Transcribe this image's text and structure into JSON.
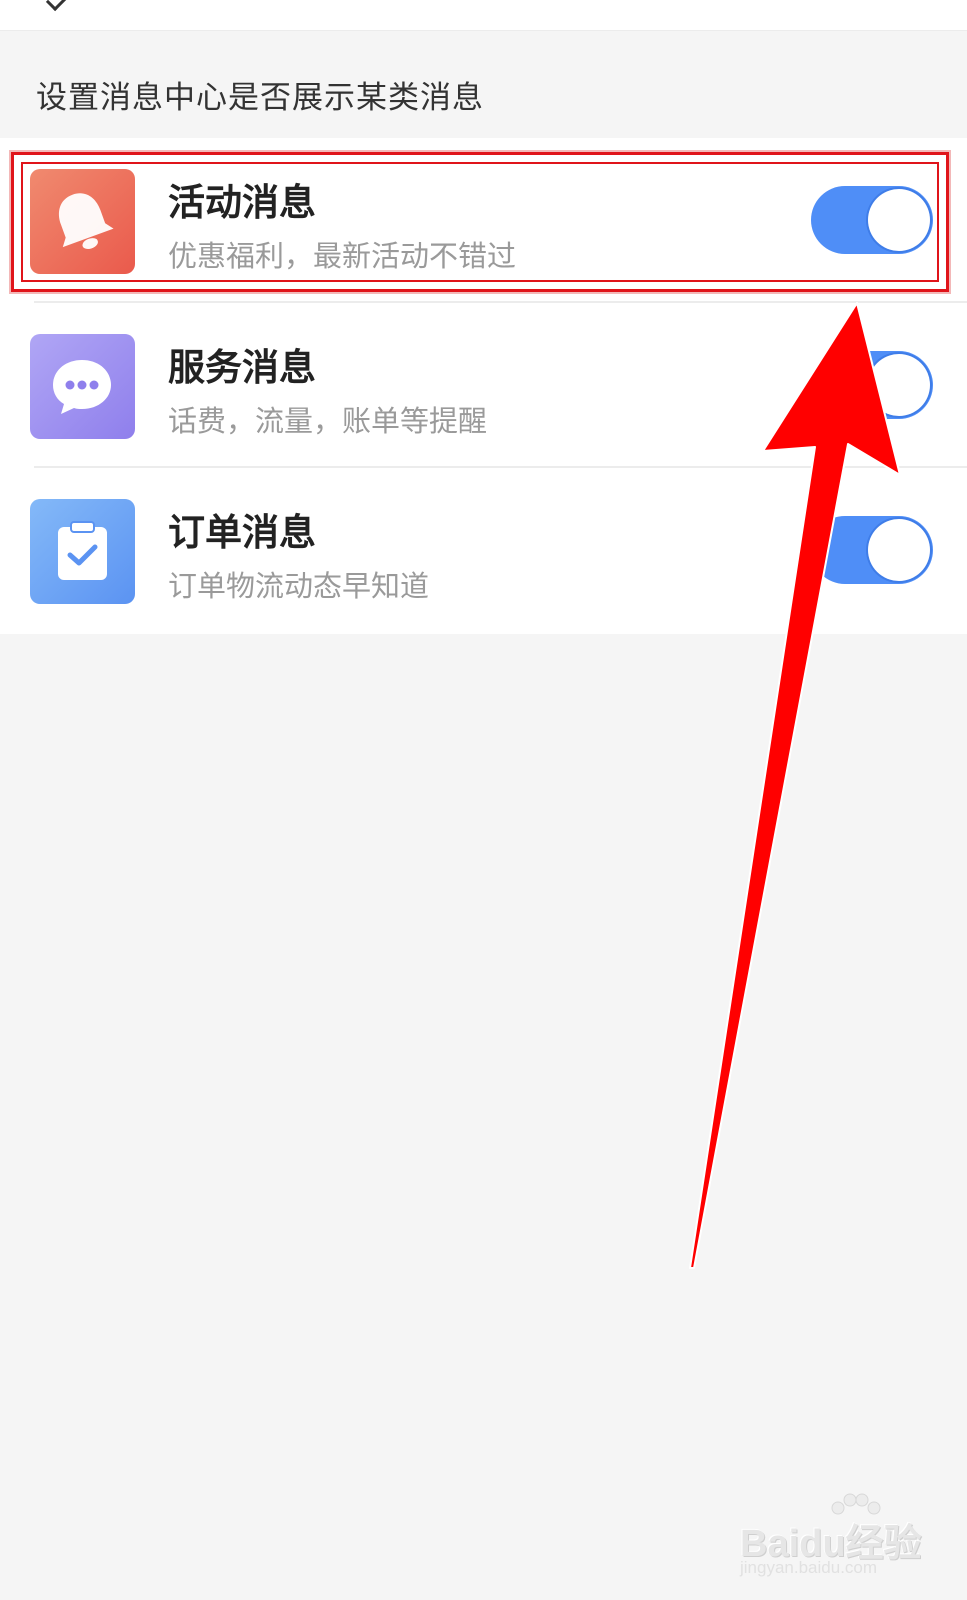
{
  "section": {
    "description": "设置消息中心是否展示某类消息"
  },
  "items": [
    {
      "title": "活动消息",
      "subtitle": "优惠福利，最新活动不错过",
      "icon": "bell-icon",
      "icon_color": "#ef6b5b",
      "enabled": true
    },
    {
      "title": "服务消息",
      "subtitle": "话费，流量，账单等提醒",
      "icon": "chat-bubble-icon",
      "icon_color": "#9b8ef0",
      "enabled": true
    },
    {
      "title": "订单消息",
      "subtitle": "订单物流动态早知道",
      "icon": "clipboard-check-icon",
      "icon_color": "#6aa8f6",
      "enabled": true
    }
  ],
  "colors": {
    "toggle_on": "#4f8ef7",
    "highlight": "#e0141a",
    "annotation_arrow": "#ff0000"
  },
  "watermark": {
    "brand": "Baidu经验",
    "url": "jingyan.baidu.com"
  }
}
